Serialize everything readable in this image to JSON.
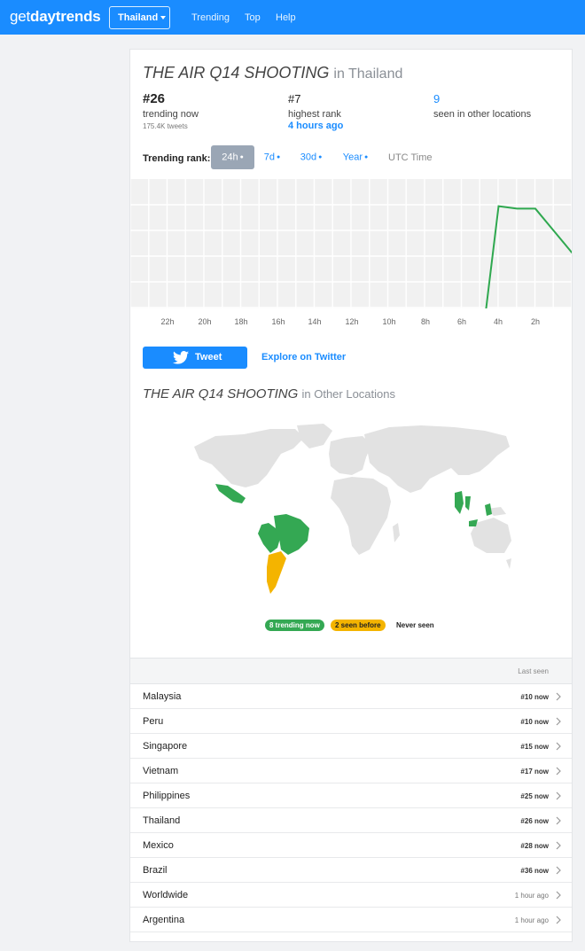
{
  "nav": {
    "brand_light": "get",
    "brand_bold": "day",
    "brand_rest": "trends",
    "country": "Thailand",
    "links": [
      "Trending",
      "Top",
      "Help"
    ],
    "brand_color": "#1a8cff"
  },
  "trend": {
    "name": "THE AIR Q14 SHOOTING",
    "location_suffix": "in Thailand",
    "stats": {
      "rank": "#26",
      "rank_label": "trending now",
      "tweets": "175.4K tweets",
      "highest": "#7",
      "highest_label": "highest rank",
      "highest_when": "4 hours ago",
      "locations_count": "9",
      "locations_label": "seen in other locations"
    }
  },
  "rank_controls": {
    "label": "Trending rank:",
    "ranges": [
      "24h",
      "7d",
      "30d",
      "Year"
    ],
    "selected": "24h",
    "timezone": "UTC Time"
  },
  "chart_data": {
    "type": "line",
    "xlabel": "",
    "ylabel": "",
    "x_ticks": [
      "22h",
      "20h",
      "18h",
      "16h",
      "14h",
      "12h",
      "10h",
      "8h",
      "6h",
      "4h",
      "2h"
    ],
    "y_reversed": true,
    "ylim": [
      50,
      1
    ],
    "grid": true,
    "series": [
      {
        "x_hours_ago": [
          4.7,
          4.0,
          3.0,
          2.0,
          1.0,
          0.0
        ],
        "rank": [
          50,
          7,
          8,
          8,
          17,
          26
        ],
        "color": "#2fa84f"
      }
    ]
  },
  "actions": {
    "tweet": "Tweet",
    "explore": "Explore on Twitter"
  },
  "other": {
    "name": "THE AIR Q14 SHOOTING",
    "suffix": "in Other Locations"
  },
  "legend": {
    "trending": "8 trending now",
    "seen_before": "2 seen before",
    "never": "Never seen",
    "colors": {
      "trending": "#34a853",
      "seen_before": "#f4b400",
      "never": "#e0e0e0"
    }
  },
  "table": {
    "header": "Last seen",
    "rows": [
      {
        "name": "Malaysia",
        "status": "#10 now"
      },
      {
        "name": "Peru",
        "status": "#10 now"
      },
      {
        "name": "Singapore",
        "status": "#15 now"
      },
      {
        "name": "Vietnam",
        "status": "#17 now"
      },
      {
        "name": "Philippines",
        "status": "#25 now"
      },
      {
        "name": "Thailand",
        "status": "#26 now"
      },
      {
        "name": "Mexico",
        "status": "#28 now"
      },
      {
        "name": "Brazil",
        "status": "#36 now"
      },
      {
        "name": "Worldwide",
        "status": "1 hour ago"
      },
      {
        "name": "Argentina",
        "status": "1 hour ago"
      }
    ]
  }
}
